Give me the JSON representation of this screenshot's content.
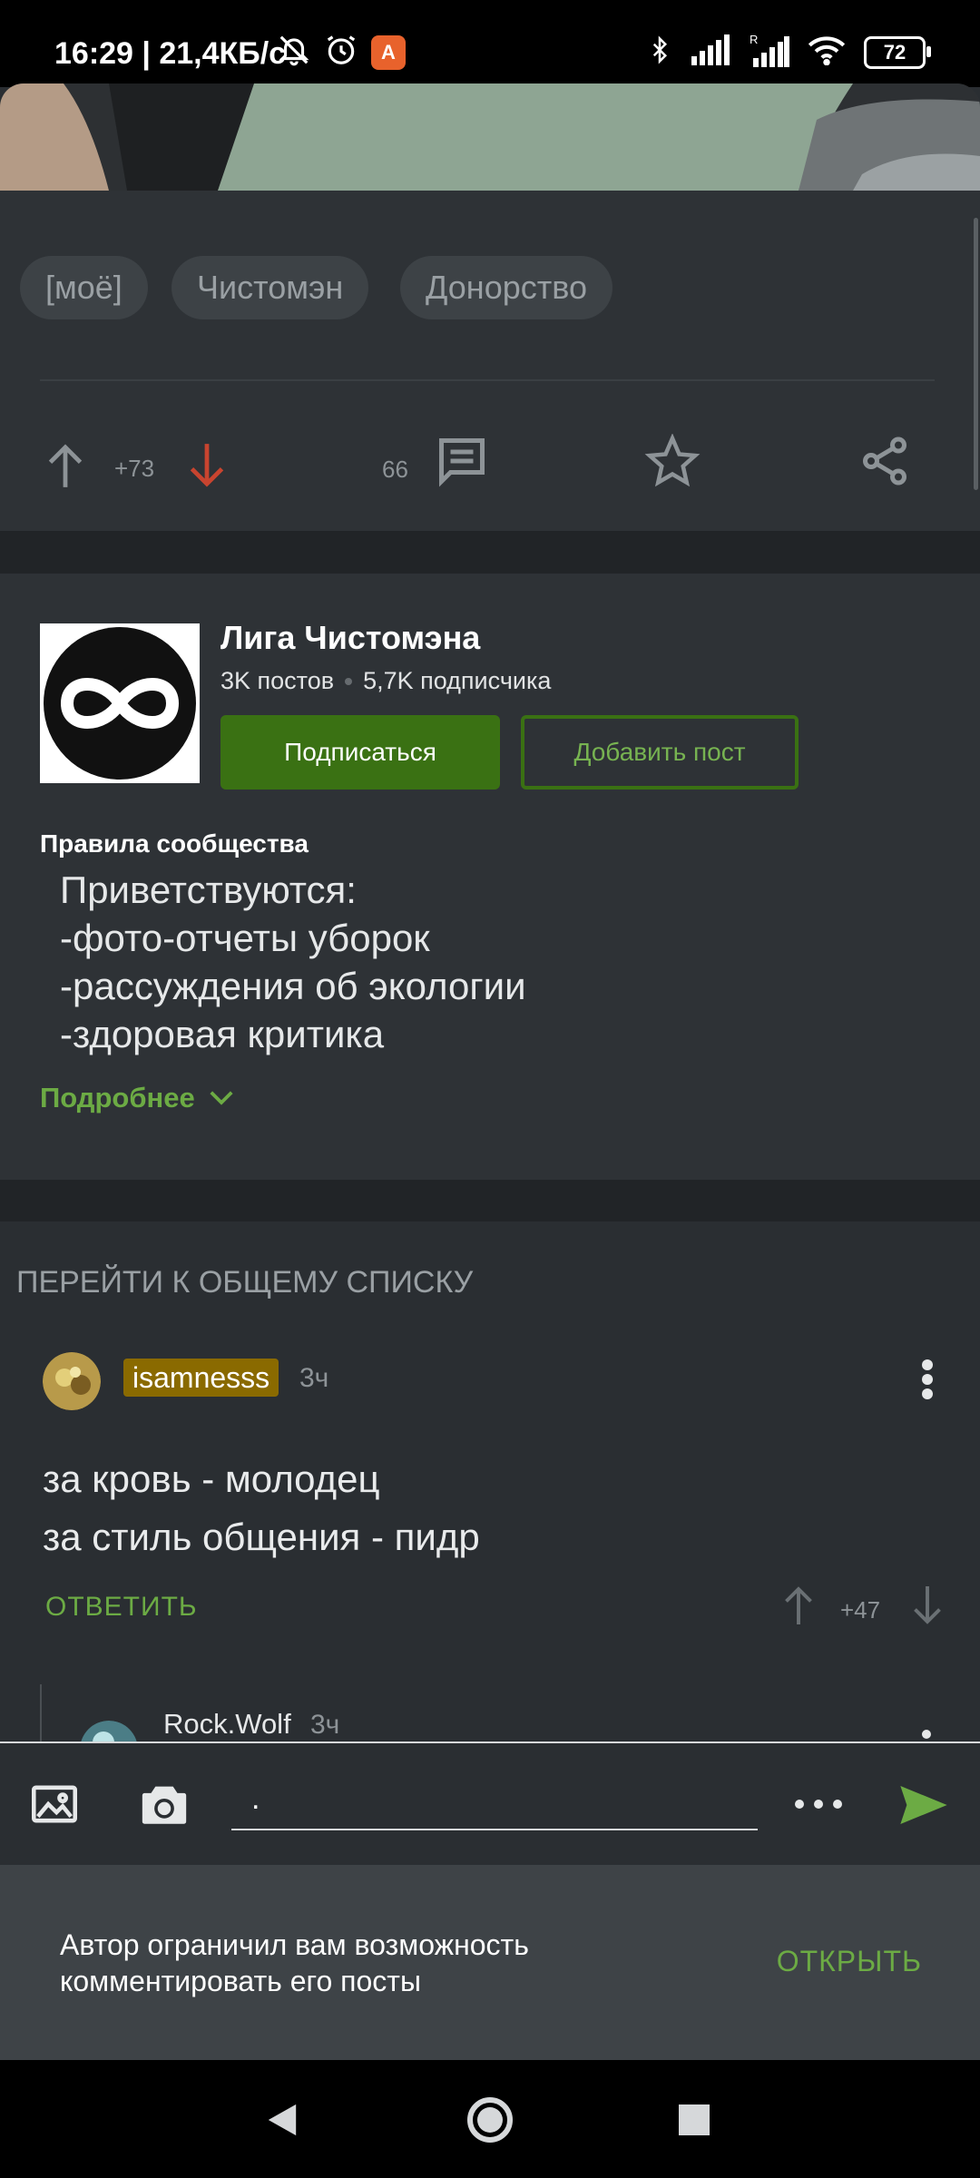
{
  "status_bar": {
    "time_speed": "16:29 | 21,4КБ/с",
    "badge_letter": "A",
    "battery": "72"
  },
  "tags": [
    "[моё]",
    "Чистомэн",
    "Донорство"
  ],
  "post_actions": {
    "rating": "+73",
    "comments_count": "66"
  },
  "community": {
    "name": "Лига Чистомэна",
    "posts": "3K постов",
    "subscribers": "5,7K подписчика",
    "subscribe_label": "Подписаться",
    "add_post_label": "Добавить пост",
    "rules_title": "Правила сообщества",
    "rules": [
      "Приветствуются:",
      "-фото-отчеты уборок",
      "-рассуждения об экологии",
      "-здоровая критика"
    ],
    "more_label": "Подробнее"
  },
  "comments": {
    "go_all_label": "ПЕРЕЙТИ К ОБЩЕМУ СПИСКУ",
    "first": {
      "username": "isamnesss",
      "time": "3ч",
      "lines": [
        "за кровь - молодец",
        "за стиль общения - пидр"
      ],
      "reply_label": "ОТВЕТИТЬ",
      "rating": "+47"
    },
    "second": {
      "username": "Rock.Wolf",
      "time": "3ч"
    }
  },
  "input": {
    "value": "."
  },
  "notice": {
    "text_line1": "Автор ограничил вам возможность",
    "text_line2": "комментировать его посты",
    "open_label": "ОТКРЫТЬ"
  },
  "colors": {
    "accent_green": "#6cab44",
    "button_green": "#3a7113",
    "downvote_red": "#c8442f",
    "username_badge": "#8a6a00"
  }
}
